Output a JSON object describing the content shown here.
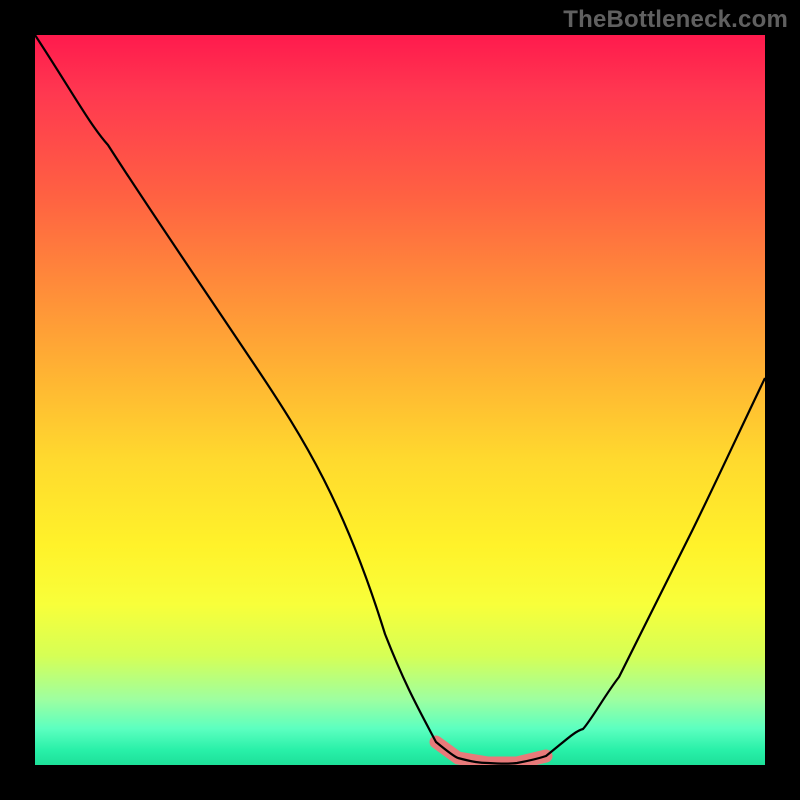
{
  "watermark": "TheBottleneck.com",
  "chart_data": {
    "type": "line",
    "title": "",
    "xlabel": "",
    "ylabel": "",
    "xlim": [
      0,
      100
    ],
    "ylim": [
      0,
      100
    ],
    "grid": false,
    "legend": false,
    "series": [
      {
        "name": "bottleneck-curve",
        "x": [
          0,
          10,
          20,
          30,
          40,
          48,
          52,
          55,
          58,
          62,
          66,
          70,
          75,
          80,
          85,
          90,
          95,
          100
        ],
        "y": [
          100,
          85,
          70,
          55,
          38,
          18,
          8,
          3,
          1,
          0,
          0,
          1,
          5,
          12,
          22,
          32,
          42,
          53
        ]
      }
    ],
    "highlight": {
      "name": "optimal-range",
      "x": [
        55,
        58,
        62,
        66,
        70
      ],
      "y": [
        3,
        1,
        0,
        0,
        1
      ]
    },
    "gradient_background": {
      "top_color": "#ff1a4d",
      "bottom_color": "#1de099",
      "meaning": "red-high-bottleneck to green-no-bottleneck"
    }
  }
}
